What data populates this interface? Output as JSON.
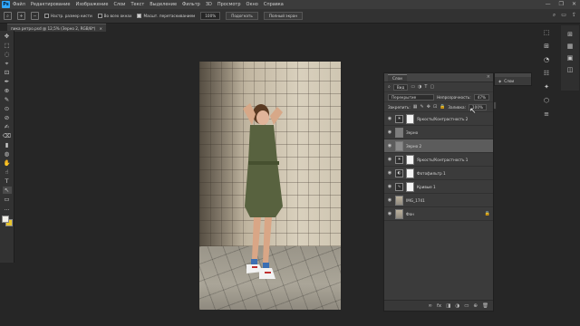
{
  "app": {
    "logo": "Ps"
  },
  "menu": [
    "Файл",
    "Редактирование",
    "Изображение",
    "Слои",
    "Текст",
    "Выделение",
    "Фильтр",
    "3D",
    "Просмотр",
    "Окно",
    "Справка"
  ],
  "window_controls": [
    "—",
    "❐",
    "✕"
  ],
  "options": {
    "check1_label": "Настр. размер кисти",
    "check2_label": "Во всех окнах",
    "check3_label": "Масшт. перетаскиванием",
    "zoom_value": "100%",
    "fit_button": "Подогнать",
    "fill_button": "Полный экран",
    "right_icons": [
      "⌕",
      "▭",
      "⇪"
    ]
  },
  "document_tab": {
    "title": "пика ретро.psd @ 12,5% (Зерно 2, RGB/8*)",
    "close": "×"
  },
  "tools": [
    "✥",
    "⬚",
    "◌",
    "⌖",
    "⊡",
    "✒",
    "⊕",
    "✎",
    "⊙",
    "⊘",
    "✍",
    "⌫",
    "▮",
    "◍",
    "✋",
    "☝",
    "T",
    "↖",
    "▭",
    "…"
  ],
  "right_strip": [
    "⬚",
    "⊞",
    "◔",
    "☷",
    "✦",
    "⬡",
    "≡"
  ],
  "right_strip2": [
    "⊞",
    "▦",
    "▣",
    "◫"
  ],
  "layers_panel": {
    "title": "Слои",
    "close": "×",
    "filter_label": "Вид",
    "blend_mode": "Перекрытие",
    "opacity_label": "Непрозрачность:",
    "opacity_value": "47%",
    "lock_label": "Закрепить:",
    "fill_label": "Заливка:",
    "fill_value": "100%",
    "layers": [
      {
        "name": "Яркость/Контрастность 2",
        "kind": "adj",
        "icon": "☀",
        "selected": false
      },
      {
        "name": "Зерно",
        "kind": "pixel",
        "selected": false
      },
      {
        "name": "Зерно 2",
        "kind": "pixel",
        "selected": true
      },
      {
        "name": "Яркость/Контрастность 1",
        "kind": "adj",
        "icon": "☀",
        "selected": false
      },
      {
        "name": "Фотофильтр 1",
        "kind": "adj",
        "icon": "◐",
        "selected": false
      },
      {
        "name": "Кривые 1",
        "kind": "adj",
        "icon": "∿",
        "selected": false
      },
      {
        "name": "IMG_1741",
        "kind": "photo",
        "selected": false
      },
      {
        "name": "Фон",
        "kind": "photo",
        "selected": false,
        "locked": true
      }
    ],
    "bottom_icons": [
      "∞",
      "fx",
      "◨",
      "◑",
      "▭",
      "⊕",
      "🗑"
    ]
  },
  "opacity_slider": {
    "value": 0.47
  },
  "mini_panel": {
    "label": "Слои",
    "icon": "◈"
  },
  "colors": {
    "foreground": "#f1efe9",
    "background": "#e9c52c",
    "selected_layer": "#5c5c5c"
  }
}
